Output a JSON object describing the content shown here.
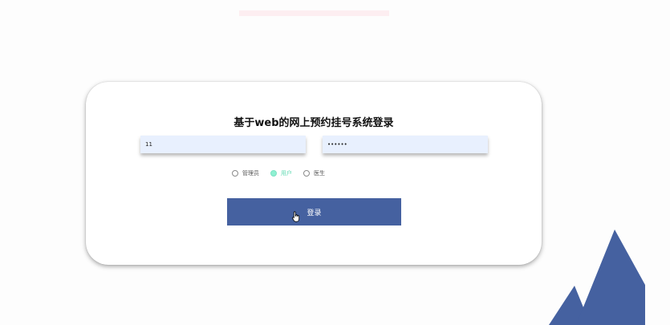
{
  "form": {
    "title": "基于web的网上预约挂号系统登录",
    "username_value": "11",
    "password_value": "111111",
    "roles": [
      {
        "label": "管理员",
        "checked": false
      },
      {
        "label": "用户",
        "checked": true
      },
      {
        "label": "医生",
        "checked": false
      }
    ],
    "login_label": "登录"
  },
  "colors": {
    "primary": "#4561a0",
    "radio_selected": "#5fd9b1",
    "input_bg": "#e8f0fe"
  },
  "icons": {
    "cursor": "hand-pointer-icon",
    "decoration": "mountains-icon"
  }
}
